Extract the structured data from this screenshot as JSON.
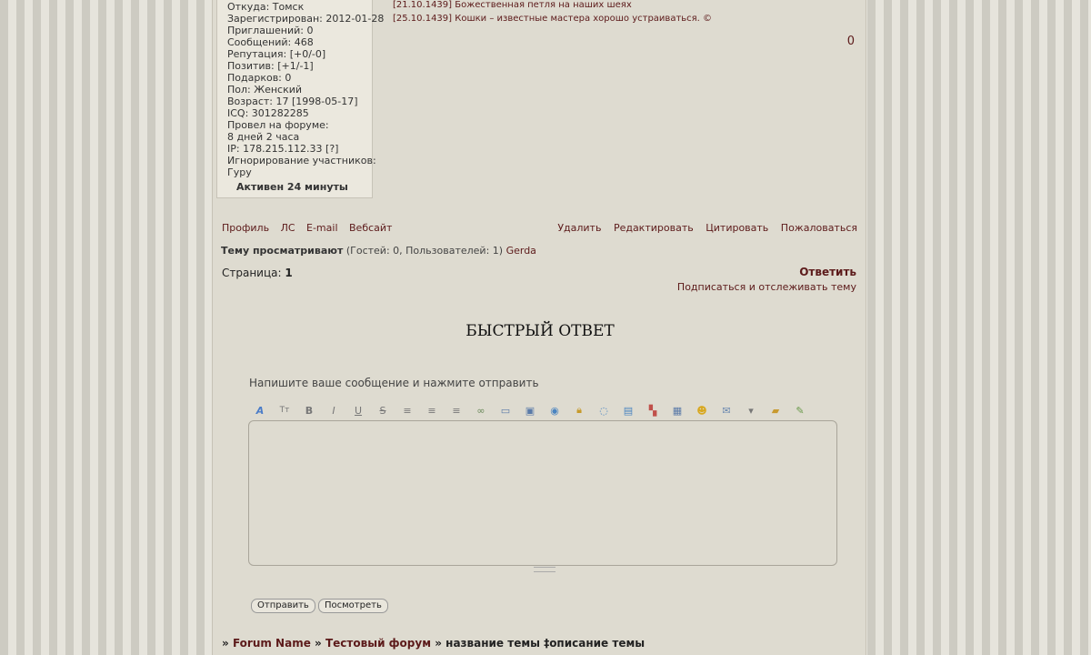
{
  "profile": {
    "from": "Откуда: Томск",
    "registered": "Зарегистрирован: 2012-01-28",
    "invites": "Приглашений: 0",
    "messages": "Сообщений: 468",
    "reputation": "Репутация: [+0/-0]",
    "positive": "Позитив: [+1/-1]",
    "gifts": "Подарков: 0",
    "gender": "Пол: Женский",
    "age": "Возраст: 17 [1998-05-17]",
    "icq": "ICQ: 301282285",
    "time_label": "Провел на форуме:",
    "time_value": "8 дней 2 часа",
    "ip": "IP: 178.215.112.33 [?]",
    "ignore_label": "Игнорирование участников:",
    "ignore_value": "Гуру",
    "active": "Активен 24 минуты"
  },
  "post": {
    "line1_date": "[21.10.1439]",
    "line1_text": " Божественная петля на наших шеях",
    "line2_date": "[25.10.1439]",
    "line2_text": " Кошки – известные мастера хорошо устраиваться. ©",
    "counter": "0"
  },
  "post_links_left": [
    "Профиль",
    "ЛС",
    "E-mail",
    "Вебсайт"
  ],
  "post_links_right": [
    "Удалить",
    "Редактировать",
    "Цитировать",
    "Пожаловаться"
  ],
  "viewers": {
    "label": "Тему просматривают",
    "detail": " (Гостей: 0, Пользователей: 1) ",
    "user": "Gerda"
  },
  "pagination": {
    "label": "Страница: ",
    "current": "1"
  },
  "reply_label": "Ответить",
  "subscribe_label": "Подписаться и отслеживать тему",
  "quick_reply": {
    "title": "БЫСТРЫЙ ОТВЕТ",
    "prompt": "Напишите ваше сообщение и нажмите отправить",
    "submit": "Отправить",
    "preview": "Посмотреть"
  },
  "toolbar_icons": [
    "font-icon",
    "font-size-icon",
    "bold-icon",
    "italic-icon",
    "underline-icon",
    "strikethrough-icon",
    "align-left-icon",
    "align-center-icon",
    "align-right-icon",
    "link-icon",
    "image-icon",
    "gallery-icon",
    "video-icon",
    "spoiler-icon",
    "quote-icon",
    "code-icon",
    "color-icon",
    "table-icon",
    "smiley-icon",
    "email-icon",
    "more-icon",
    "upload-icon",
    "edit-icon"
  ],
  "breadcrumb": {
    "sep": "»",
    "forum": "Forum Name",
    "subforum": "Тестовый форум",
    "topic": "название темы",
    "desc_sep": "‡",
    "desc": "описание темы"
  }
}
